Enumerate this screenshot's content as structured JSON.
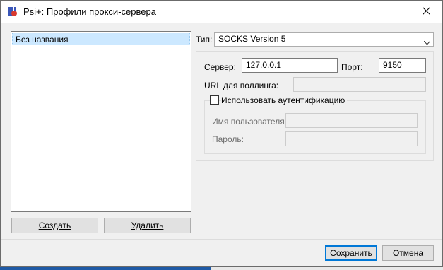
{
  "window": {
    "title": "Psi+: Профили прокси-сервера",
    "app_icon": "psi-plus-icon",
    "close_icon": "close-icon"
  },
  "profiles": {
    "items": [
      {
        "label": "Без названия",
        "selected": true
      }
    ],
    "create_label": "Создать",
    "delete_label": "Удалить"
  },
  "settings": {
    "type_label": "Тип:",
    "type_value": "SOCKS Version 5",
    "server_label": "Сервер:",
    "server_value": "127.0.0.1",
    "port_label": "Порт:",
    "port_value": "9150",
    "polling_label": "URL для поллинга:",
    "polling_value": "",
    "auth": {
      "checkbox_label": "Использовать аутентификацию",
      "checked": false,
      "username_label": "Имя пользователя:",
      "username_value": "",
      "password_label": "Пароль:",
      "password_value": ""
    }
  },
  "footer": {
    "save_label": "Сохранить",
    "cancel_label": "Отмена"
  },
  "colors": {
    "selection": "#cce8ff",
    "default_button_border": "#0078d7",
    "taskbar_accent": "#1f5aa6"
  }
}
